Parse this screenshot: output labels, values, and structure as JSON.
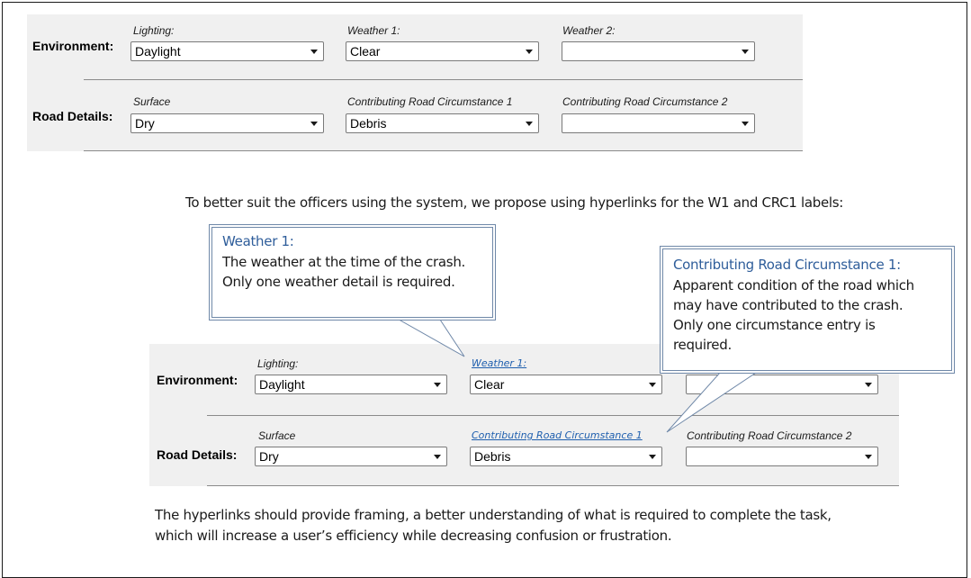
{
  "top_form": {
    "environment": {
      "label": "Environment:",
      "fields": [
        {
          "label": "Lighting:",
          "value": "Daylight"
        },
        {
          "label": "Weather 1:",
          "value": "Clear"
        },
        {
          "label": "Weather 2:",
          "value": ""
        }
      ]
    },
    "road_details": {
      "label": "Road Details:",
      "fields": [
        {
          "label": "Surface",
          "value": "Dry"
        },
        {
          "label": "Contributing Road Circumstance 1",
          "value": "Debris"
        },
        {
          "label": "Contributing Road Circumstance 2",
          "value": ""
        }
      ]
    }
  },
  "intro_text": "To better suit the officers using the system, we propose using hyperlinks for the W1 and CRC1 labels:",
  "callout_weather": {
    "title": "Weather 1:",
    "lines": [
      "The weather at the time of the crash.",
      "Only one weather detail is required."
    ]
  },
  "callout_road": {
    "title": "Contributing Road Circumstance 1:",
    "lines": [
      "Apparent condition of the road which",
      "may have contributed to the crash.",
      "Only one circumstance entry is",
      "required."
    ]
  },
  "bottom_form": {
    "environment": {
      "label": "Environment:",
      "fields": [
        {
          "label": "Lighting:",
          "value": "Daylight"
        },
        {
          "label": "Weather 1:",
          "value": "Clear",
          "hyperlink": true
        },
        {
          "label": "",
          "value": ""
        }
      ]
    },
    "road_details": {
      "label": "Road Details:",
      "fields": [
        {
          "label": "Surface",
          "value": "Dry"
        },
        {
          "label": "Contributing Road Circumstance 1",
          "value": "Debris",
          "hyperlink": true
        },
        {
          "label": "Contributing Road Circumstance 2",
          "value": ""
        }
      ]
    }
  },
  "closing_text": {
    "line1": "The hyperlinks should provide framing, a better understanding of what is required to complete the task,",
    "line2": "which will increase a user’s efficiency while decreasing confusion or frustration."
  },
  "colors": {
    "link": "#1f5fae",
    "callout_border": "#6f88a8",
    "callout_title": "#2e5d9a",
    "panel_bg": "#f0f0f0"
  }
}
